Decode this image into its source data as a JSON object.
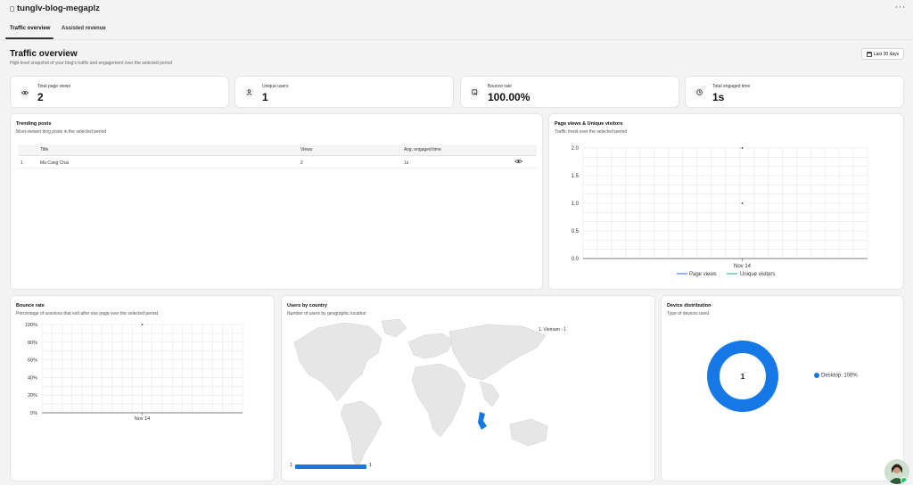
{
  "app": {
    "title": "tunglv-blog-megaplz",
    "more_label": "···"
  },
  "tabs": [
    {
      "label": "Traffic overview",
      "active": true
    },
    {
      "label": "Assisted revenue",
      "active": false
    }
  ],
  "page": {
    "title": "Traffic overview",
    "subtitle": "High-level snapshot of your blog's traffic and engagement over the selected period",
    "range_label": "Last 30 days"
  },
  "kpis": [
    {
      "label": "Total page views",
      "value": "2",
      "icon": "eye-icon"
    },
    {
      "label": "Unique users",
      "value": "1",
      "icon": "user-icon"
    },
    {
      "label": "Bounce rate",
      "value": "100.00%",
      "icon": "bounce-icon"
    },
    {
      "label": "Total engaged time",
      "value": "1s",
      "icon": "clock-icon"
    }
  ],
  "trending": {
    "title": "Trending posts",
    "subtitle": "Most-viewed blog posts in the selected period",
    "columns": [
      "Title",
      "Views",
      "Avg. engaged time"
    ],
    "rows": [
      {
        "rank": "1",
        "title": "Mu Cang Chai",
        "views": "2",
        "time": "1s"
      }
    ]
  },
  "pageviews": {
    "title": "Page views & Unique visitors",
    "subtitle": "Traffic trend over the selected period"
  },
  "bounce": {
    "title": "Bounce rate",
    "subtitle": "Percentage of sessions that exit after one page over the selected period"
  },
  "country": {
    "title": "Users by country",
    "subtitle": "Number of users by geographic location",
    "legend_item": "1. Vietnam - 1",
    "scale_min": "1",
    "scale_max": "1"
  },
  "device": {
    "title": "Device distribution",
    "subtitle": "Type of devices used",
    "center_value": "1",
    "legend": "Desktop: 100%"
  },
  "colors": {
    "accent": "#1677e6",
    "page_bg": "#f3f3f3",
    "card_bg": "#ffffff",
    "map_land": "#e6e6e6",
    "map_highlight": "#1677e6"
  },
  "chart_data": [
    {
      "type": "line",
      "x": [
        "Nov 14"
      ],
      "series": [
        {
          "name": "Page views",
          "values": [
            2
          ]
        },
        {
          "name": "Unique visitors",
          "values": [
            1
          ]
        }
      ],
      "yticks": [
        "0.0",
        "0.5",
        "1.0",
        "1.5",
        "2.0"
      ],
      "ylim": [
        0,
        2
      ],
      "grid": true,
      "legend_position": "bottom"
    },
    {
      "type": "line",
      "x": [
        "Nov 14"
      ],
      "series": [
        {
          "values": [
            100
          ]
        }
      ],
      "yticks": [
        "0%",
        "20%",
        "40%",
        "60%",
        "80%",
        "100%"
      ],
      "ylim": [
        0,
        100
      ],
      "grid": true
    },
    {
      "type": "pie",
      "categories": [
        "Desktop"
      ],
      "values": [
        1
      ],
      "legend_position": "right"
    }
  ]
}
